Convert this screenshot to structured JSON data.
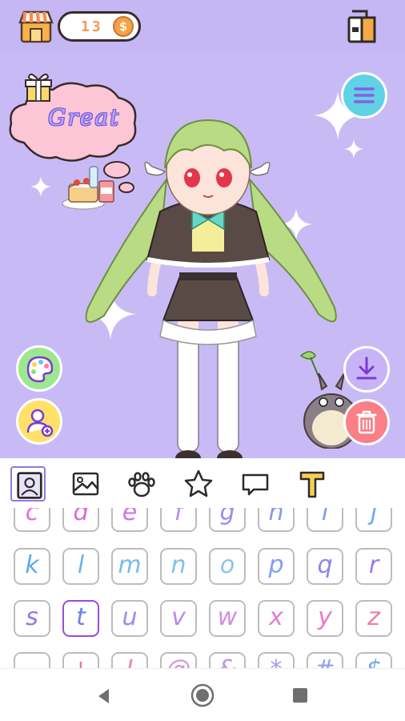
{
  "topbar": {
    "coins": "13",
    "coin_symbol": "$",
    "icons": {
      "shop": "shop-icon",
      "wardrobe": "wardrobe-icon"
    }
  },
  "stage": {
    "thought_text": "Great",
    "icons": {
      "menu": "hamburger-menu-icon",
      "palette": "palette-icon",
      "add_character": "add-person-icon",
      "download": "download-icon",
      "delete": "trash-icon",
      "gift": "gift-icon"
    }
  },
  "tabs": [
    {
      "name": "portrait",
      "icon": "portrait-frame-icon",
      "active": true
    },
    {
      "name": "background",
      "icon": "image-icon",
      "active": false
    },
    {
      "name": "pets",
      "icon": "paw-icon",
      "active": false
    },
    {
      "name": "stickers",
      "icon": "star-icon",
      "active": false
    },
    {
      "name": "speech",
      "icon": "speech-bubble-icon",
      "active": false
    },
    {
      "name": "text",
      "icon": "text-icon",
      "active": false
    }
  ],
  "letters": {
    "row0": [
      "c",
      "d",
      "e",
      "f",
      "g",
      "h",
      "i",
      "j"
    ],
    "row1": [
      "k",
      "l",
      "m",
      "n",
      "o",
      "p",
      "q",
      "r"
    ],
    "row2": [
      "s",
      "t",
      "u",
      "v",
      "w",
      "x",
      "y",
      "z"
    ],
    "row3": [
      "-",
      "+",
      "!",
      "@",
      "&",
      "*",
      "#",
      "$"
    ],
    "selected": "t",
    "colors": {
      "row0": [
        "#e96bd9",
        "#d96ae0",
        "#c978e8",
        "#b98bee",
        "#9c8cf0",
        "#8a93f2",
        "#7a9df2",
        "#6aa8f4"
      ],
      "row1": [
        "#5aa8ef",
        "#6bb2ee",
        "#78bbee",
        "#80c2ea",
        "#8ac7e8",
        "#7d9ff0",
        "#8a84f0",
        "#9a7aea"
      ],
      "row2": [
        "#8a7af0",
        "#6d7ef2",
        "#9b8bf2",
        "#b38cf0",
        "#d08be6",
        "#e27fd6",
        "#ee78c4",
        "#f07aa2"
      ],
      "row3": [
        "#f07a92",
        "#f07a92",
        "#e98ab0",
        "#d890d6",
        "#c494e6",
        "#a89af0",
        "#8ea0f2",
        "#7aa4f4"
      ]
    }
  },
  "navbar": {
    "icons": {
      "back": "nav-back-icon",
      "home": "nav-home-icon",
      "recent": "nav-recent-icon"
    }
  }
}
